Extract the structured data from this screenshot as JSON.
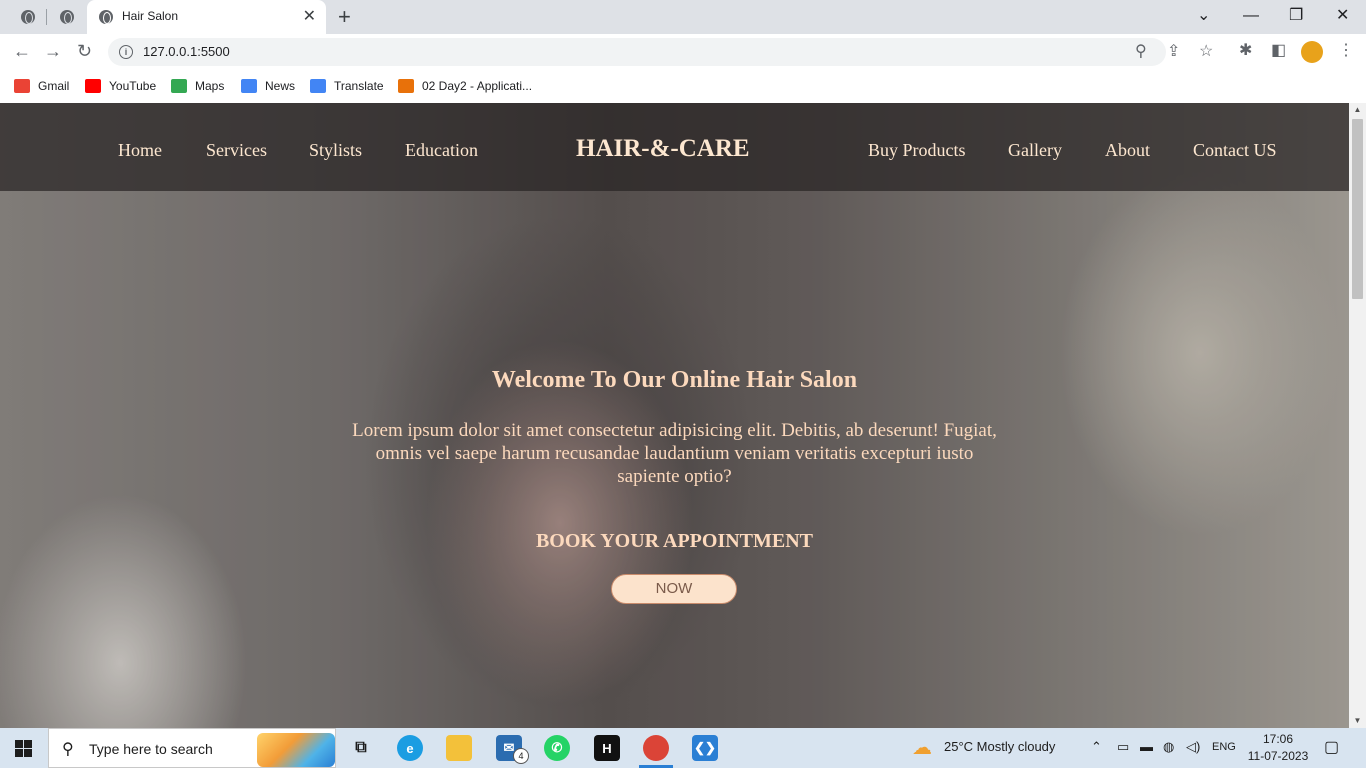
{
  "browser": {
    "tab_title": "Hair Salon",
    "tab_close": "✕",
    "new_tab": "+",
    "url": "127.0.0.1:5500",
    "window_controls": {
      "minimize": "—",
      "restore": "❐",
      "close": "✕"
    }
  },
  "bookmarks": [
    {
      "label": "Gmail",
      "icon": "gmail-icon",
      "color": "#ea4335"
    },
    {
      "label": "YouTube",
      "icon": "youtube-icon",
      "color": "#ff0000"
    },
    {
      "label": "Maps",
      "icon": "maps-icon",
      "color": "#34a853"
    },
    {
      "label": "News",
      "icon": "news-icon",
      "color": "#4285f4"
    },
    {
      "label": "Translate",
      "icon": "translate-icon",
      "color": "#4285f4"
    },
    {
      "label": "02 Day2 - Applicati...",
      "icon": "app-icon",
      "color": "#e8710a"
    }
  ],
  "site": {
    "nav_left": [
      "Home",
      "Services",
      "Stylists",
      "Education"
    ],
    "brand": "HAIR-&-CARE",
    "nav_right": [
      "Buy Products",
      "Gallery",
      "About",
      "Contact US"
    ],
    "hero": {
      "title": "Welcome To Our Online Hair Salon",
      "text": "Lorem ipsum dolor sit amet consectetur adipisicing elit. Debitis, ab deserunt! Fugiat, omnis vel saepe harum recusandae laudantium veniam veritatis excepturi iusto sapiente optio?",
      "subtitle": "BOOK YOUR APPOINTMENT",
      "button": "NOW"
    }
  },
  "taskbar": {
    "search_placeholder": "Type here to search",
    "mail_badge": "4",
    "weather": "25°C  Mostly cloudy",
    "language": "ENG",
    "time": "17:06",
    "date": "11-07-2023"
  }
}
